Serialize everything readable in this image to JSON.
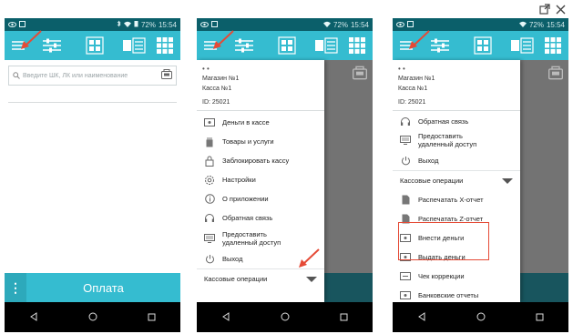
{
  "window_controls": [
    "popup",
    "close"
  ],
  "status_bar": {
    "time": "15:54",
    "battery": "72%"
  },
  "toolbar_icons": [
    "menu-icon",
    "sliders-icon",
    "grid-4-icon",
    "cards-icon",
    "grid-9-icon"
  ],
  "screen1": {
    "search": {
      "placeholder": "Введите ШК, ЛК или наименование"
    },
    "pay_button": "Оплата"
  },
  "drawer": {
    "dots": "• •",
    "shop": "Магазин №1",
    "register": "Касса №1",
    "id": "ID: 25021"
  },
  "screen2": {
    "menu": [
      {
        "icon": "cash-icon",
        "label": "Деньги в кассе"
      },
      {
        "icon": "goods-icon",
        "label": "Товары и услуги"
      },
      {
        "icon": "lock-icon",
        "label": "Заблокировать кассу"
      },
      {
        "icon": "gear-icon",
        "label": "Настройки"
      },
      {
        "icon": "info-icon",
        "label": "О приложении"
      },
      {
        "icon": "headset-icon",
        "label": "Обратная связь"
      },
      {
        "icon": "remote-icon",
        "label_line1": "Предоставить",
        "label_line2": "удаленный доступ"
      },
      {
        "icon": "power-icon",
        "label": "Выход"
      }
    ],
    "section": "Кассовые операции"
  },
  "screen3": {
    "menu_top": [
      {
        "icon": "headset-icon",
        "label": "Обратная связь"
      },
      {
        "icon": "remote-icon",
        "label_line1": "Предоставить",
        "label_line2": "удаленный доступ"
      },
      {
        "icon": "power-icon",
        "label": "Выход"
      }
    ],
    "section": "Кассовые операции",
    "menu_ops": [
      {
        "icon": "doc-icon",
        "label": "Распечатать X-отчет"
      },
      {
        "icon": "doc-icon",
        "label": "Распечатать Z-отчет"
      },
      {
        "icon": "cash-in-icon",
        "label": "Внести деньги"
      },
      {
        "icon": "cash-out-icon",
        "label": "Выдать деньги"
      },
      {
        "icon": "receipt-icon",
        "label": "Чек коррекции"
      },
      {
        "icon": "bank-icon",
        "label": "Банковские отчеты"
      }
    ]
  },
  "colors": {
    "accent": "#35bcd0",
    "statusbar": "#0b5f6a",
    "highlight": "#e54a36"
  }
}
